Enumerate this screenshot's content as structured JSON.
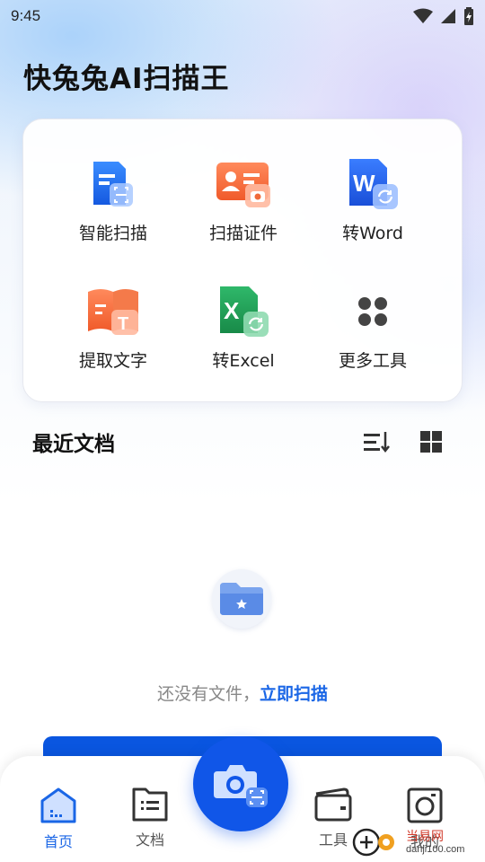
{
  "status_bar": {
    "time": "9:45"
  },
  "app_title": "快兔兔AI扫描王",
  "tools": [
    {
      "label": "智能扫描",
      "icon": "smart-scan-icon"
    },
    {
      "label": "扫描证件",
      "icon": "id-card-scan-icon"
    },
    {
      "label": "转Word",
      "icon": "word-convert-icon"
    },
    {
      "label": "提取文字",
      "icon": "extract-text-icon"
    },
    {
      "label": "转Excel",
      "icon": "excel-convert-icon"
    },
    {
      "label": "更多工具",
      "icon": "more-tools-icon"
    }
  ],
  "recent": {
    "title": "最近文档",
    "empty_text": "还没有文件，",
    "empty_link": "立即扫描"
  },
  "nav": [
    {
      "label": "首页",
      "icon": "home-icon",
      "active": true
    },
    {
      "label": "文档",
      "icon": "documents-icon",
      "active": false
    },
    {
      "label": "工具",
      "icon": "tools-icon",
      "active": false
    },
    {
      "label": "我的",
      "icon": "profile-icon",
      "active": false
    }
  ],
  "watermark": {
    "brand": "当易网",
    "site": "danji100.com",
    "badge": "100网"
  },
  "colors": {
    "primary": "#1056e8",
    "link": "#1a66e6",
    "title": "#111111"
  }
}
